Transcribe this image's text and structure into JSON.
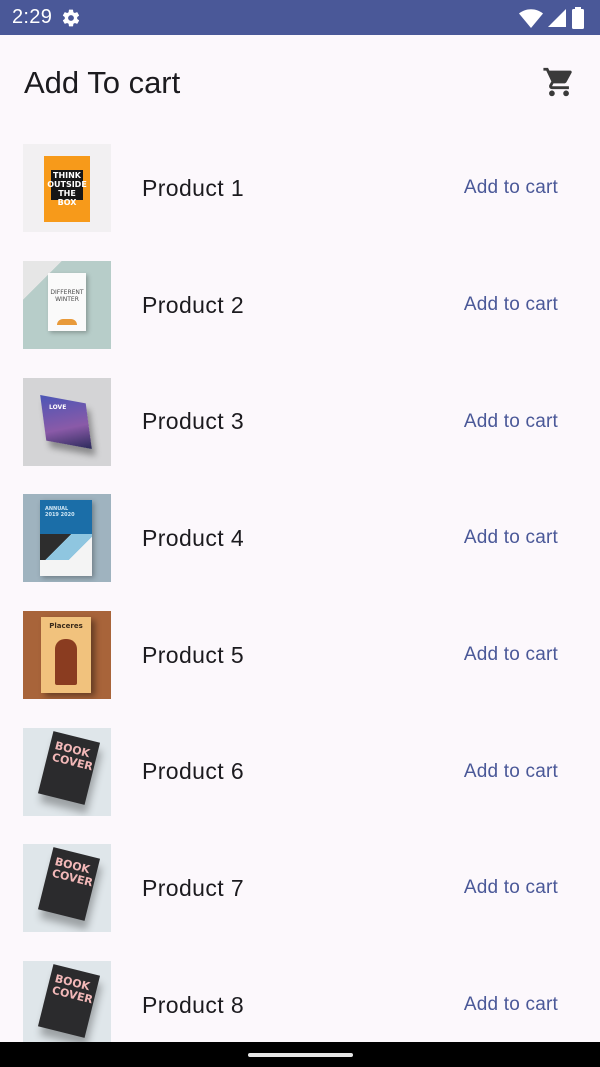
{
  "status_bar": {
    "time": "2:29",
    "icons": [
      "gear-icon",
      "wifi-icon",
      "signal-icon",
      "battery-icon"
    ]
  },
  "app_bar": {
    "title": "Add To cart",
    "cart_icon": "cart-icon"
  },
  "products": [
    {
      "name": "Product 1",
      "action": "Add to cart",
      "cover_text": "THINK OUTSIDE THE BOX"
    },
    {
      "name": "Product 2",
      "action": "Add to cart",
      "cover_text": "DIFFERENT WINTER"
    },
    {
      "name": "Product 3",
      "action": "Add to cart",
      "cover_text": "LOVE"
    },
    {
      "name": "Product 4",
      "action": "Add to cart",
      "cover_text": "ANNUAL 2019 2020"
    },
    {
      "name": "Product 5",
      "action": "Add to cart",
      "cover_text": "Placeres"
    },
    {
      "name": "Product 6",
      "action": "Add to cart",
      "cover_text": "BOOK COVER"
    },
    {
      "name": "Product 7",
      "action": "Add to cart",
      "cover_text": "BOOK COVER"
    },
    {
      "name": "Product 8",
      "action": "Add to cart",
      "cover_text": "BOOK COVER"
    }
  ],
  "colors": {
    "primary": "#4a5898",
    "background": "#fcf8fc",
    "text": "#1c1b1f"
  }
}
